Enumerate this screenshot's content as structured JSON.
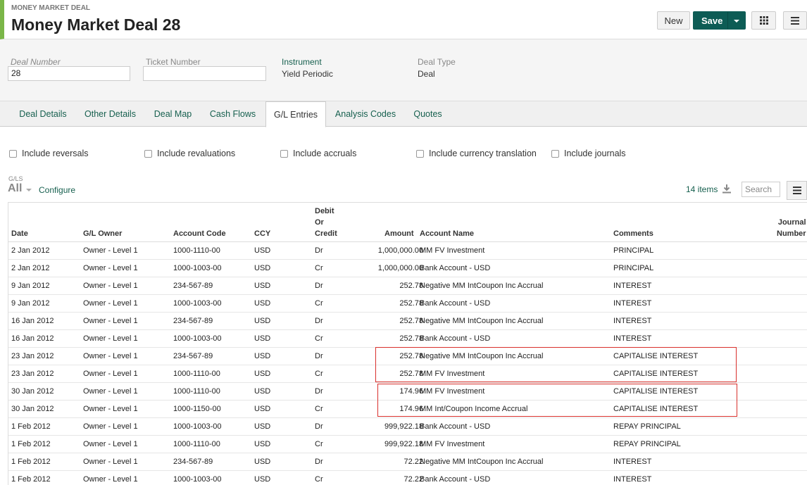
{
  "header": {
    "eyebrow": "MONEY MARKET DEAL",
    "title": "Money Market Deal 28",
    "new_label": "New",
    "save_label": "Save"
  },
  "fields": {
    "deal_number_label": "Deal Number",
    "deal_number_value": "28",
    "ticket_number_label": "Ticket Number",
    "ticket_number_value": "",
    "instrument_label": "Instrument",
    "instrument_value": "Yield Periodic",
    "deal_type_label": "Deal Type",
    "deal_type_value": "Deal"
  },
  "tabs": [
    "Deal Details",
    "Other Details",
    "Deal Map",
    "Cash Flows",
    "G/L Entries",
    "Analysis Codes",
    "Quotes"
  ],
  "active_tab": "G/L Entries",
  "checkboxes": [
    "Include reversals",
    "Include revaluations",
    "Include accruals",
    "Include currency translation",
    "Include journals"
  ],
  "gls": {
    "label": "G/LS",
    "filter": "All",
    "configure": "Configure",
    "items_count": "14 items",
    "search_placeholder": "Search"
  },
  "table": {
    "headers": {
      "date": "Date",
      "gl_owner": "G/L Owner",
      "account_code": "Account Code",
      "ccy": "CCY",
      "debit_credit_1": "Debit",
      "debit_credit_2": "Or",
      "debit_credit_3": "Credit",
      "amount": "Amount",
      "account_name": "Account Name",
      "comments": "Comments",
      "journal_1": "Journal",
      "journal_2": "Number"
    },
    "rows": [
      {
        "date": "2 Jan 2012",
        "owner": "Owner - Level 1",
        "code": "1000-1110-00",
        "ccy": "USD",
        "dc": "Dr",
        "amount": "1,000,000.00",
        "name": "MM FV Investment",
        "comments": "PRINCIPAL"
      },
      {
        "date": "2 Jan 2012",
        "owner": "Owner - Level 1",
        "code": "1000-1003-00",
        "ccy": "USD",
        "dc": "Cr",
        "amount": "1,000,000.00",
        "name": "Bank Account - USD",
        "comments": "PRINCIPAL"
      },
      {
        "date": "9 Jan 2012",
        "owner": "Owner - Level 1",
        "code": "234-567-89",
        "ccy": "USD",
        "dc": "Dr",
        "amount": "252.78",
        "name": "Negative MM IntCoupon Inc Accrual",
        "comments": "INTEREST"
      },
      {
        "date": "9 Jan 2012",
        "owner": "Owner - Level 1",
        "code": "1000-1003-00",
        "ccy": "USD",
        "dc": "Cr",
        "amount": "252.78",
        "name": "Bank Account - USD",
        "comments": "INTEREST"
      },
      {
        "date": "16 Jan 2012",
        "owner": "Owner - Level 1",
        "code": "234-567-89",
        "ccy": "USD",
        "dc": "Dr",
        "amount": "252.78",
        "name": "Negative MM IntCoupon Inc Accrual",
        "comments": "INTEREST"
      },
      {
        "date": "16 Jan 2012",
        "owner": "Owner - Level 1",
        "code": "1000-1003-00",
        "ccy": "USD",
        "dc": "Cr",
        "amount": "252.78",
        "name": "Bank Account - USD",
        "comments": "INTEREST"
      },
      {
        "date": "23 Jan 2012",
        "owner": "Owner - Level 1",
        "code": "234-567-89",
        "ccy": "USD",
        "dc": "Dr",
        "amount": "252.78",
        "name": "Negative MM IntCoupon Inc Accrual",
        "comments": "CAPITALISE INTEREST"
      },
      {
        "date": "23 Jan 2012",
        "owner": "Owner - Level 1",
        "code": "1000-1110-00",
        "ccy": "USD",
        "dc": "Cr",
        "amount": "252.78",
        "name": "MM FV Investment",
        "comments": "CAPITALISE INTEREST"
      },
      {
        "date": "30 Jan 2012",
        "owner": "Owner - Level 1",
        "code": "1000-1110-00",
        "ccy": "USD",
        "dc": "Dr",
        "amount": "174.96",
        "name": "MM FV Investment",
        "comments": "CAPITALISE INTEREST"
      },
      {
        "date": "30 Jan 2012",
        "owner": "Owner - Level 1",
        "code": "1000-1150-00",
        "ccy": "USD",
        "dc": "Cr",
        "amount": "174.96",
        "name": "MM Int/Coupon Income Accrual",
        "comments": "CAPITALISE INTEREST"
      },
      {
        "date": "1 Feb 2012",
        "owner": "Owner - Level 1",
        "code": "1000-1003-00",
        "ccy": "USD",
        "dc": "Dr",
        "amount": "999,922.18",
        "name": "Bank Account - USD",
        "comments": "REPAY PRINCIPAL"
      },
      {
        "date": "1 Feb 2012",
        "owner": "Owner - Level 1",
        "code": "1000-1110-00",
        "ccy": "USD",
        "dc": "Cr",
        "amount": "999,922.18",
        "name": "MM FV Investment",
        "comments": "REPAY PRINCIPAL"
      },
      {
        "date": "1 Feb 2012",
        "owner": "Owner - Level 1",
        "code": "234-567-89",
        "ccy": "USD",
        "dc": "Dr",
        "amount": "72.22",
        "name": "Negative MM IntCoupon Inc Accrual",
        "comments": "INTEREST"
      },
      {
        "date": "1 Feb 2012",
        "owner": "Owner - Level 1",
        "code": "1000-1003-00",
        "ccy": "USD",
        "dc": "Cr",
        "amount": "72.22",
        "name": "Bank Account - USD",
        "comments": "INTEREST"
      }
    ]
  },
  "highlights": [
    {
      "rows": [
        6,
        7
      ],
      "color": "#d9302c"
    },
    {
      "rows": [
        8,
        9
      ],
      "color": "#d9302c"
    }
  ],
  "colors": {
    "brand_green": "#7ab648",
    "save_button": "#0d5c55",
    "link": "#17604f",
    "highlight": "#d9302c"
  }
}
